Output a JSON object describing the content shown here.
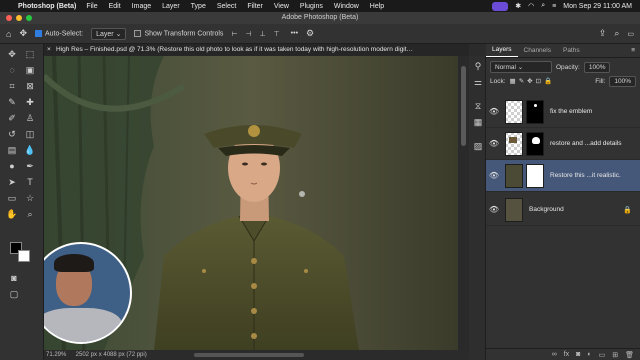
{
  "menubar": {
    "app": "Photoshop (Beta)",
    "items": [
      "File",
      "Edit",
      "Image",
      "Layer",
      "Type",
      "Select",
      "Filter",
      "View",
      "Plugins",
      "Window",
      "Help"
    ],
    "datetime": "Mon Sep 29  11:00 AM"
  },
  "window": {
    "title": "Adobe Photoshop (Beta)"
  },
  "options": {
    "auto_select_label": "Auto-Select:",
    "auto_select_value": "Layer",
    "transform_label": "Show Transform Controls"
  },
  "document": {
    "tab_title": "High Res – Finished.psd @ 71.3% (Restore this old photo to look as if it was taken today with high-resolution modern digit…"
  },
  "status": {
    "zoom": "71.29%",
    "doc_size": "2502 px x 4088 px (72 ppi)"
  },
  "panel": {
    "tabs": [
      "Layers",
      "Channels",
      "Paths"
    ],
    "blend_mode": "Normal",
    "opacity_label": "Opacity:",
    "opacity_value": "100%",
    "lock_label": "Lock:",
    "fill_label": "Fill:",
    "fill_value": "100%",
    "layers": [
      {
        "name": "fix the emblem"
      },
      {
        "name": "restore and ...add details"
      },
      {
        "name": "Restore this ...it realistic."
      },
      {
        "name": "Background"
      }
    ]
  },
  "colors": {
    "accent": "#2f7de1",
    "selected_layer": "#46587a",
    "brand_purple": "#6a4bd6"
  }
}
